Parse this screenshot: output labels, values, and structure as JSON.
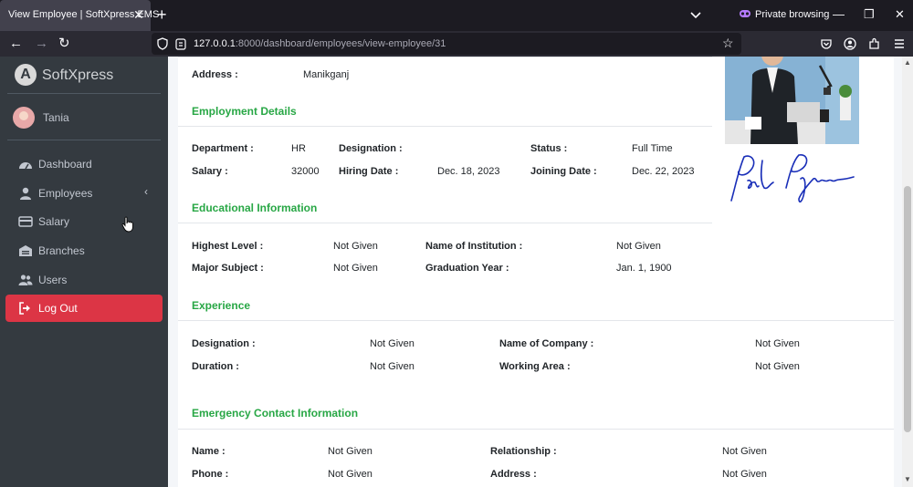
{
  "browser": {
    "tab_title": "View Employee | SoftXpress EMS",
    "tab_close": "✕",
    "new_tab": "+",
    "private_label": "Private browsing",
    "minimize": "—",
    "restore": "❐",
    "close": "✕",
    "back": "←",
    "forward": "→",
    "reload": "↻",
    "url_host": "127.0.0.1",
    "url_path": ":8000/dashboard/employees/view-employee/31",
    "bookmark": "☆"
  },
  "sidebar": {
    "brand": "SoftXpress",
    "brand_logo": "A",
    "user_name": "Tania",
    "items": [
      {
        "label": "Dashboard",
        "icon": "dashboard-icon"
      },
      {
        "label": "Employees",
        "icon": "user-icon",
        "caret": "‹"
      },
      {
        "label": "Salary",
        "icon": "card-icon"
      },
      {
        "label": "Branches",
        "icon": "building-icon"
      },
      {
        "label": "Users",
        "icon": "users-icon"
      },
      {
        "label": "Log Out",
        "icon": "logout-icon"
      }
    ]
  },
  "employee": {
    "address_label": "Address :",
    "address": "Manikganj"
  },
  "employment": {
    "title": "Employment Details",
    "department_label": "Department :",
    "department": "HR",
    "designation_label": "Designation :",
    "designation": "",
    "status_label": "Status :",
    "status": "Full Time",
    "salary_label": "Salary :",
    "salary": "32000",
    "hiring_date_label": "Hiring Date :",
    "hiring_date": "Dec. 18, 2023",
    "joining_date_label": "Joining Date :",
    "joining_date": "Dec. 22, 2023"
  },
  "education": {
    "title": "Educational Information",
    "highest_level_label": "Highest Level :",
    "highest_level": "Not Given",
    "institution_label": "Name of Institution :",
    "institution": "Not Given",
    "major_label": "Major Subject :",
    "major": "Not Given",
    "graduation_label": "Graduation Year :",
    "graduation": "Jan. 1, 1900"
  },
  "experience": {
    "title": "Experience",
    "designation_label": "Designation :",
    "designation": "Not Given",
    "company_label": "Name of Company :",
    "company": "Not Given",
    "duration_label": "Duration :",
    "duration": "Not Given",
    "area_label": "Working Area :",
    "area": "Not Given"
  },
  "emergency": {
    "title": "Emergency Contact Information",
    "name_label": "Name :",
    "name": "Not Given",
    "relationship_label": "Relationship :",
    "relationship": "Not Given",
    "phone_label": "Phone :",
    "phone": "Not Given",
    "address_label": "Address :",
    "address": "Not Given"
  },
  "colors": {
    "sidebar_bg": "#343a40",
    "accent_green": "#28a745",
    "logout_red": "#dc3545"
  }
}
